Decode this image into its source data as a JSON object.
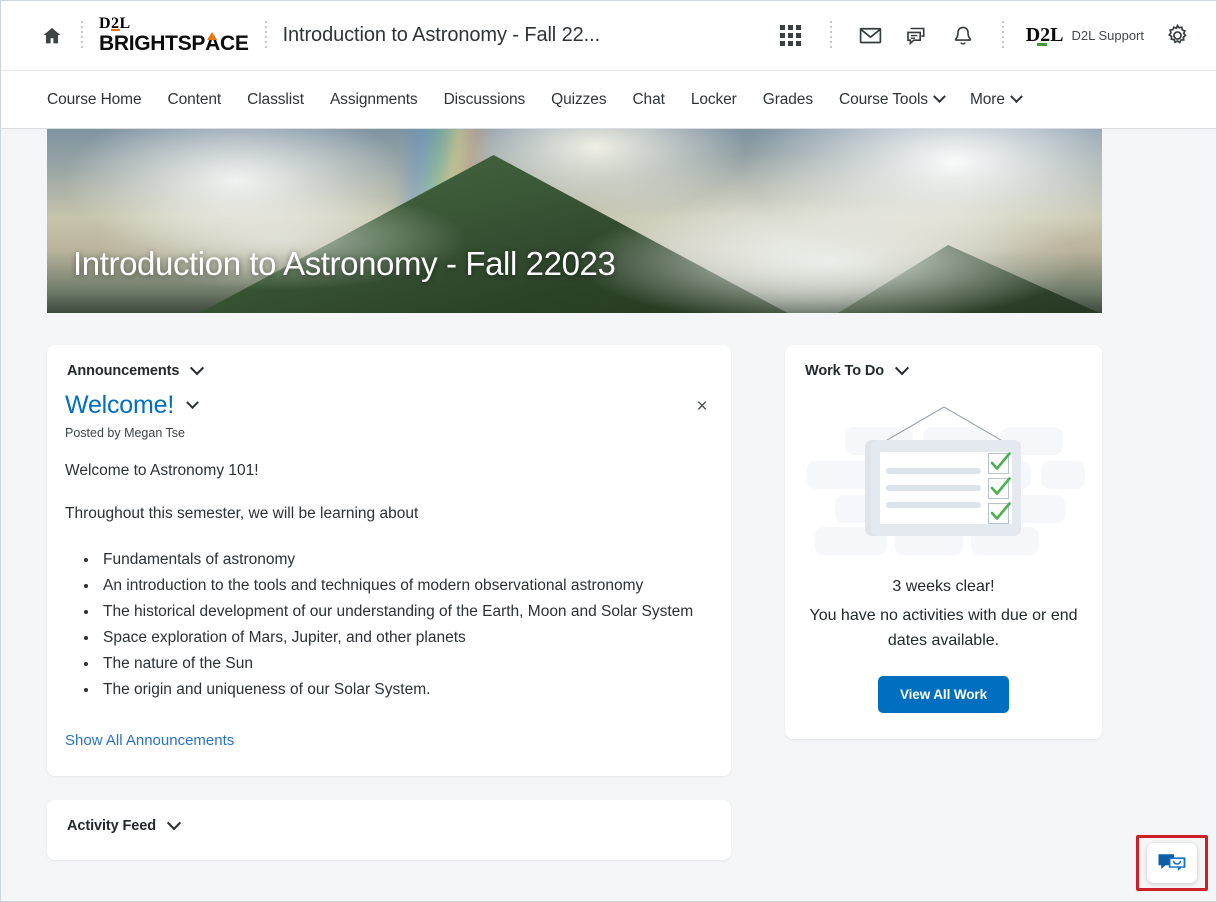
{
  "topbar": {
    "home_icon": "home-icon",
    "brand": {
      "d2l": "D2L",
      "brightspace_pre": "BRIGHTSP",
      "brightspace_a": "A",
      "brightspace_post": "CE"
    },
    "course_title": "Introduction to Astronomy - Fall 22...",
    "icons": [
      "waffle-grid-icon",
      "envelope-icon",
      "chat-bubbles-icon",
      "bell-icon"
    ],
    "support_logo": "D2L",
    "support_label": "D2L Support",
    "settings_icon": "gear-icon"
  },
  "coursenav": {
    "items": [
      {
        "label": "Course Home",
        "dropdown": false
      },
      {
        "label": "Content",
        "dropdown": false
      },
      {
        "label": "Classlist",
        "dropdown": false
      },
      {
        "label": "Assignments",
        "dropdown": false
      },
      {
        "label": "Discussions",
        "dropdown": false
      },
      {
        "label": "Quizzes",
        "dropdown": false
      },
      {
        "label": "Chat",
        "dropdown": false
      },
      {
        "label": "Locker",
        "dropdown": false
      },
      {
        "label": "Grades",
        "dropdown": false
      },
      {
        "label": "Course Tools",
        "dropdown": true
      },
      {
        "label": "More",
        "dropdown": true
      }
    ]
  },
  "banner": {
    "title": "Introduction to Astronomy - Fall 22023",
    "image_description": "mountain-landscape-with-clouds-and-rainbow"
  },
  "announcements": {
    "widget_title": "Announcements",
    "post_title": "Welcome!",
    "posted_by": "Posted by Megan Tse",
    "close_label": "×",
    "paragraphs": [
      "Welcome to Astronomy 101!",
      "Throughout this semester, we will be learning about"
    ],
    "bullets": [
      "Fundamentals of astronomy",
      "An introduction to the tools and techniques of modern observational astronomy",
      "The historical development of our understanding of the Earth, Moon and Solar System",
      "Space exploration of Mars, Jupiter, and other planets",
      "The nature of the Sun",
      "The origin and uniqueness of our Solar System."
    ],
    "show_all_link": "Show All Announcements"
  },
  "activity_feed": {
    "widget_title": "Activity Feed"
  },
  "work_to_do": {
    "widget_title": "Work To Do",
    "illustration": "hanging-checklist-board-illustration",
    "headline": "3 weeks clear!",
    "subtext": "You have no activities with due or end dates available.",
    "button_label": "View All Work"
  },
  "chat_widget": {
    "icon": "chat-bubble-smile-icon",
    "highlight_color": "#cc2027"
  },
  "colors": {
    "accent_blue": "#006fbf",
    "link_blue": "#2a72c4",
    "page_bg": "#f4f5f6",
    "brand_orange": "#e87511",
    "brand_green": "#3f9c35",
    "check_green": "#4caf50"
  }
}
